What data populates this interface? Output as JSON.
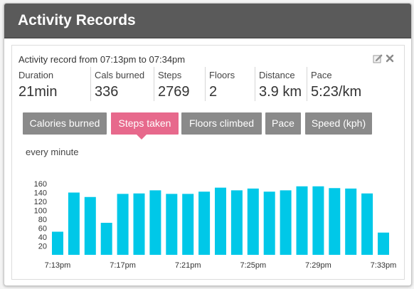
{
  "header": {
    "title": "Activity Records"
  },
  "record": {
    "summary": "Activity record from 07:13pm to 07:34pm",
    "stats": [
      {
        "label": "Duration",
        "value": "21min"
      },
      {
        "label": "Cals burned",
        "value": "336"
      },
      {
        "label": "Steps",
        "value": "2769"
      },
      {
        "label": "Floors",
        "value": "2"
      },
      {
        "label": "Distance",
        "value": "3.9 km"
      },
      {
        "label": "Pace",
        "value": "5:23/km"
      }
    ],
    "edit_icon": "pencil-icon",
    "close_icon": "close-icon"
  },
  "tabs": [
    {
      "label": "Calories burned",
      "active": false
    },
    {
      "label": "Steps taken",
      "active": true
    },
    {
      "label": "Floors climbed",
      "active": false
    },
    {
      "label": "Pace",
      "active": false
    },
    {
      "label": "Speed (kph)",
      "active": false
    }
  ],
  "colors": {
    "header": "#5a5a5a",
    "tab": "#8a8a8a",
    "tab_active": "#e7698c",
    "bar": "#00c8e8"
  },
  "chart": {
    "interval": "every minute"
  },
  "chart_data": {
    "type": "bar",
    "title": "",
    "xlabel": "",
    "ylabel": "",
    "ylim": [
      0,
      160
    ],
    "yticks": [
      20,
      40,
      60,
      80,
      100,
      120,
      140,
      160
    ],
    "categories": [
      "7:13pm",
      "7:14pm",
      "7:15pm",
      "7:16pm",
      "7:17pm",
      "7:18pm",
      "7:19pm",
      "7:20pm",
      "7:21pm",
      "7:22pm",
      "7:23pm",
      "7:24pm",
      "7:25pm",
      "7:26pm",
      "7:27pm",
      "7:28pm",
      "7:29pm",
      "7:30pm",
      "7:31pm",
      "7:32pm",
      "7:33pm"
    ],
    "tick_labels": [
      "7:13pm",
      "7:17pm",
      "7:21pm",
      "7:25pm",
      "7:29pm",
      "7:33pm"
    ],
    "values": [
      52,
      140,
      130,
      72,
      137,
      138,
      145,
      137,
      137,
      142,
      151,
      145,
      149,
      142,
      145,
      154,
      154,
      150,
      149,
      138,
      50
    ],
    "grid": false,
    "legend": "none"
  }
}
